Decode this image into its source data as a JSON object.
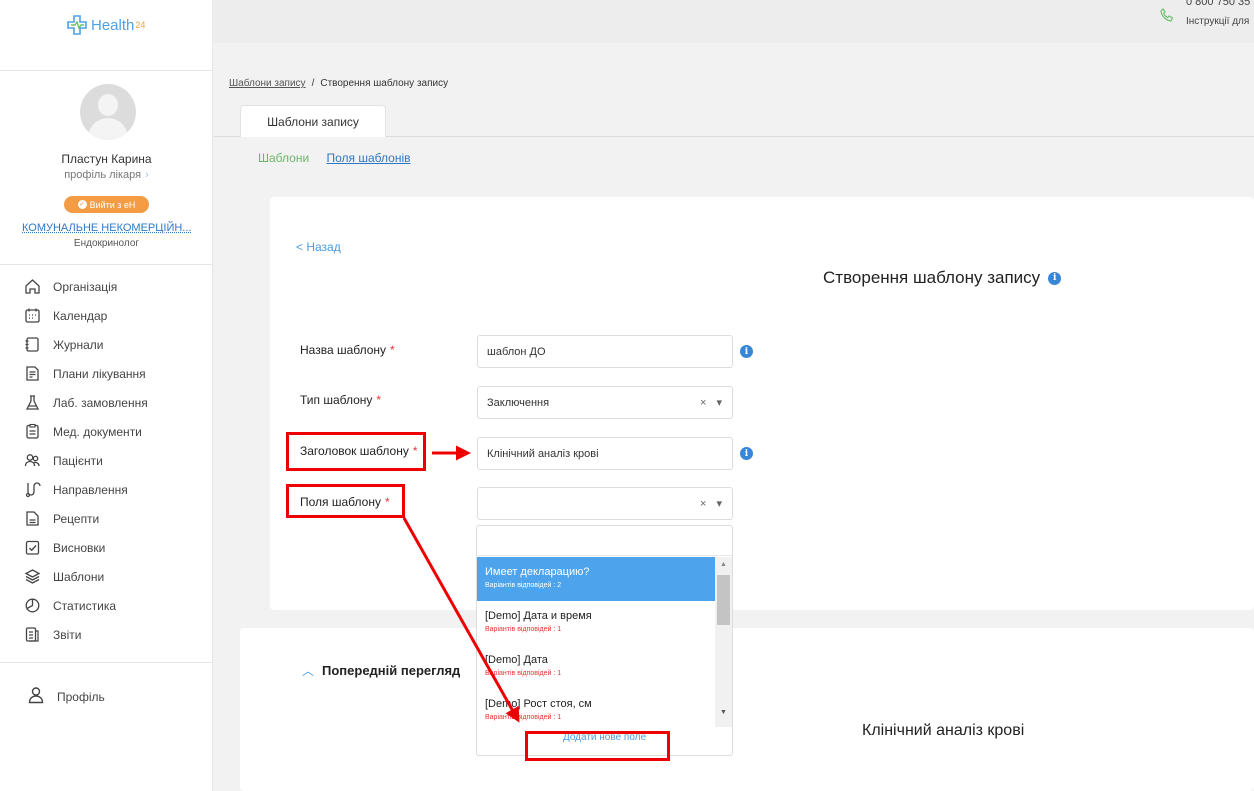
{
  "app": {
    "logo_text": "Health",
    "logo_sup": "24"
  },
  "topbar": {
    "phone": "0 800 750 35",
    "instructions": "Інструкції для"
  },
  "user": {
    "name": "Пластун Карина",
    "profile_link": "профіль лікаря",
    "ehealth_button": "Вийти з еН",
    "organization": "КОМУНАЛЬНЕ НЕКОМЕРЦІЙН...",
    "specialty": "Ендокринолог"
  },
  "menu": [
    {
      "label": "Організація",
      "icon": "home-icon"
    },
    {
      "label": "Календар",
      "icon": "calendar-icon"
    },
    {
      "label": "Журнали",
      "icon": "journal-icon"
    },
    {
      "label": "Плани лікування",
      "icon": "treatment-plan-icon"
    },
    {
      "label": "Лаб. замовлення",
      "icon": "flask-icon"
    },
    {
      "label": "Мед. документи",
      "icon": "clipboard-icon"
    },
    {
      "label": "Пацієнти",
      "icon": "patients-icon"
    },
    {
      "label": "Направлення",
      "icon": "referral-icon"
    },
    {
      "label": "Рецепти",
      "icon": "prescription-icon"
    },
    {
      "label": "Висновки",
      "icon": "conclusion-icon"
    },
    {
      "label": "Шаблони",
      "icon": "layers-icon"
    },
    {
      "label": "Статистика",
      "icon": "pie-chart-icon"
    },
    {
      "label": "Звіти",
      "icon": "report-icon"
    }
  ],
  "profile_menu": {
    "label": "Профіль",
    "icon": "user-icon"
  },
  "breadcrumb": {
    "link": "Шаблони запису",
    "separator": "/",
    "current": "Створення шаблону запису"
  },
  "tab": {
    "label": "Шаблони запису"
  },
  "subtabs": {
    "templates": "Шаблони",
    "fields": "Поля шаблонів"
  },
  "form": {
    "back": "< Назад",
    "title": "Створення шаблону запису",
    "name_label": "Назва шаблону",
    "name_value": "шаблон ДО",
    "type_label": "Тип шаблону",
    "type_value": "Заключення",
    "header_label": "Заголовок шаблону",
    "header_value": "Клінічний аналіз крові",
    "fields_label": "Поля шаблону",
    "fields_value": "",
    "required_mark": "*",
    "clear_symbol": "×",
    "caret_symbol": "▾"
  },
  "dropdown": {
    "options": [
      {
        "title": "Имеет декларацию?",
        "sub": "Варіантів відповідей : 2",
        "selected": true
      },
      {
        "title": "[Demo] Дата и время",
        "sub": "Варіантів відповідей : 1",
        "selected": false
      },
      {
        "title": "[Demo] Дата",
        "sub": "Варіантів відповідей : 1",
        "selected": false
      },
      {
        "title": "[Demo] Рост стоя, см",
        "sub": "Варіантів відповідей : 1",
        "selected": false
      }
    ],
    "add_new": "Додати нове поле"
  },
  "preview": {
    "heading": "Попередній перегляд",
    "title": "Клінічний аналіз крові"
  },
  "colors": {
    "accent": "#4a9be0",
    "selected": "#4da3ec",
    "annotation": "#e00000",
    "ehealth": "#f39c44"
  }
}
